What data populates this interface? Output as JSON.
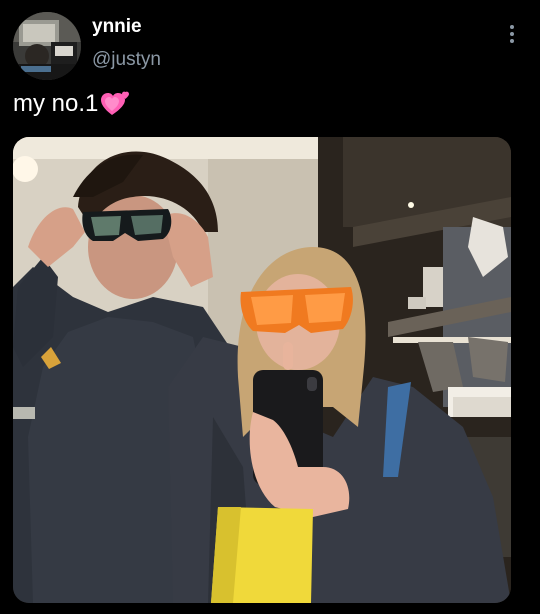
{
  "tweet": {
    "author": {
      "display_name": "ynnie",
      "handle": "@justyn"
    },
    "text": "my no.1",
    "text_emoji": "growing-heart-emoji",
    "menu_icon": "more-vertical-icon",
    "media": {
      "kind": "photo",
      "description_icon": "photo"
    }
  },
  "colors": {
    "background": "#000000",
    "text_primary": "#ffffff",
    "text_secondary": "#8b98a5",
    "emoji_pink": "#ff5fb5"
  }
}
